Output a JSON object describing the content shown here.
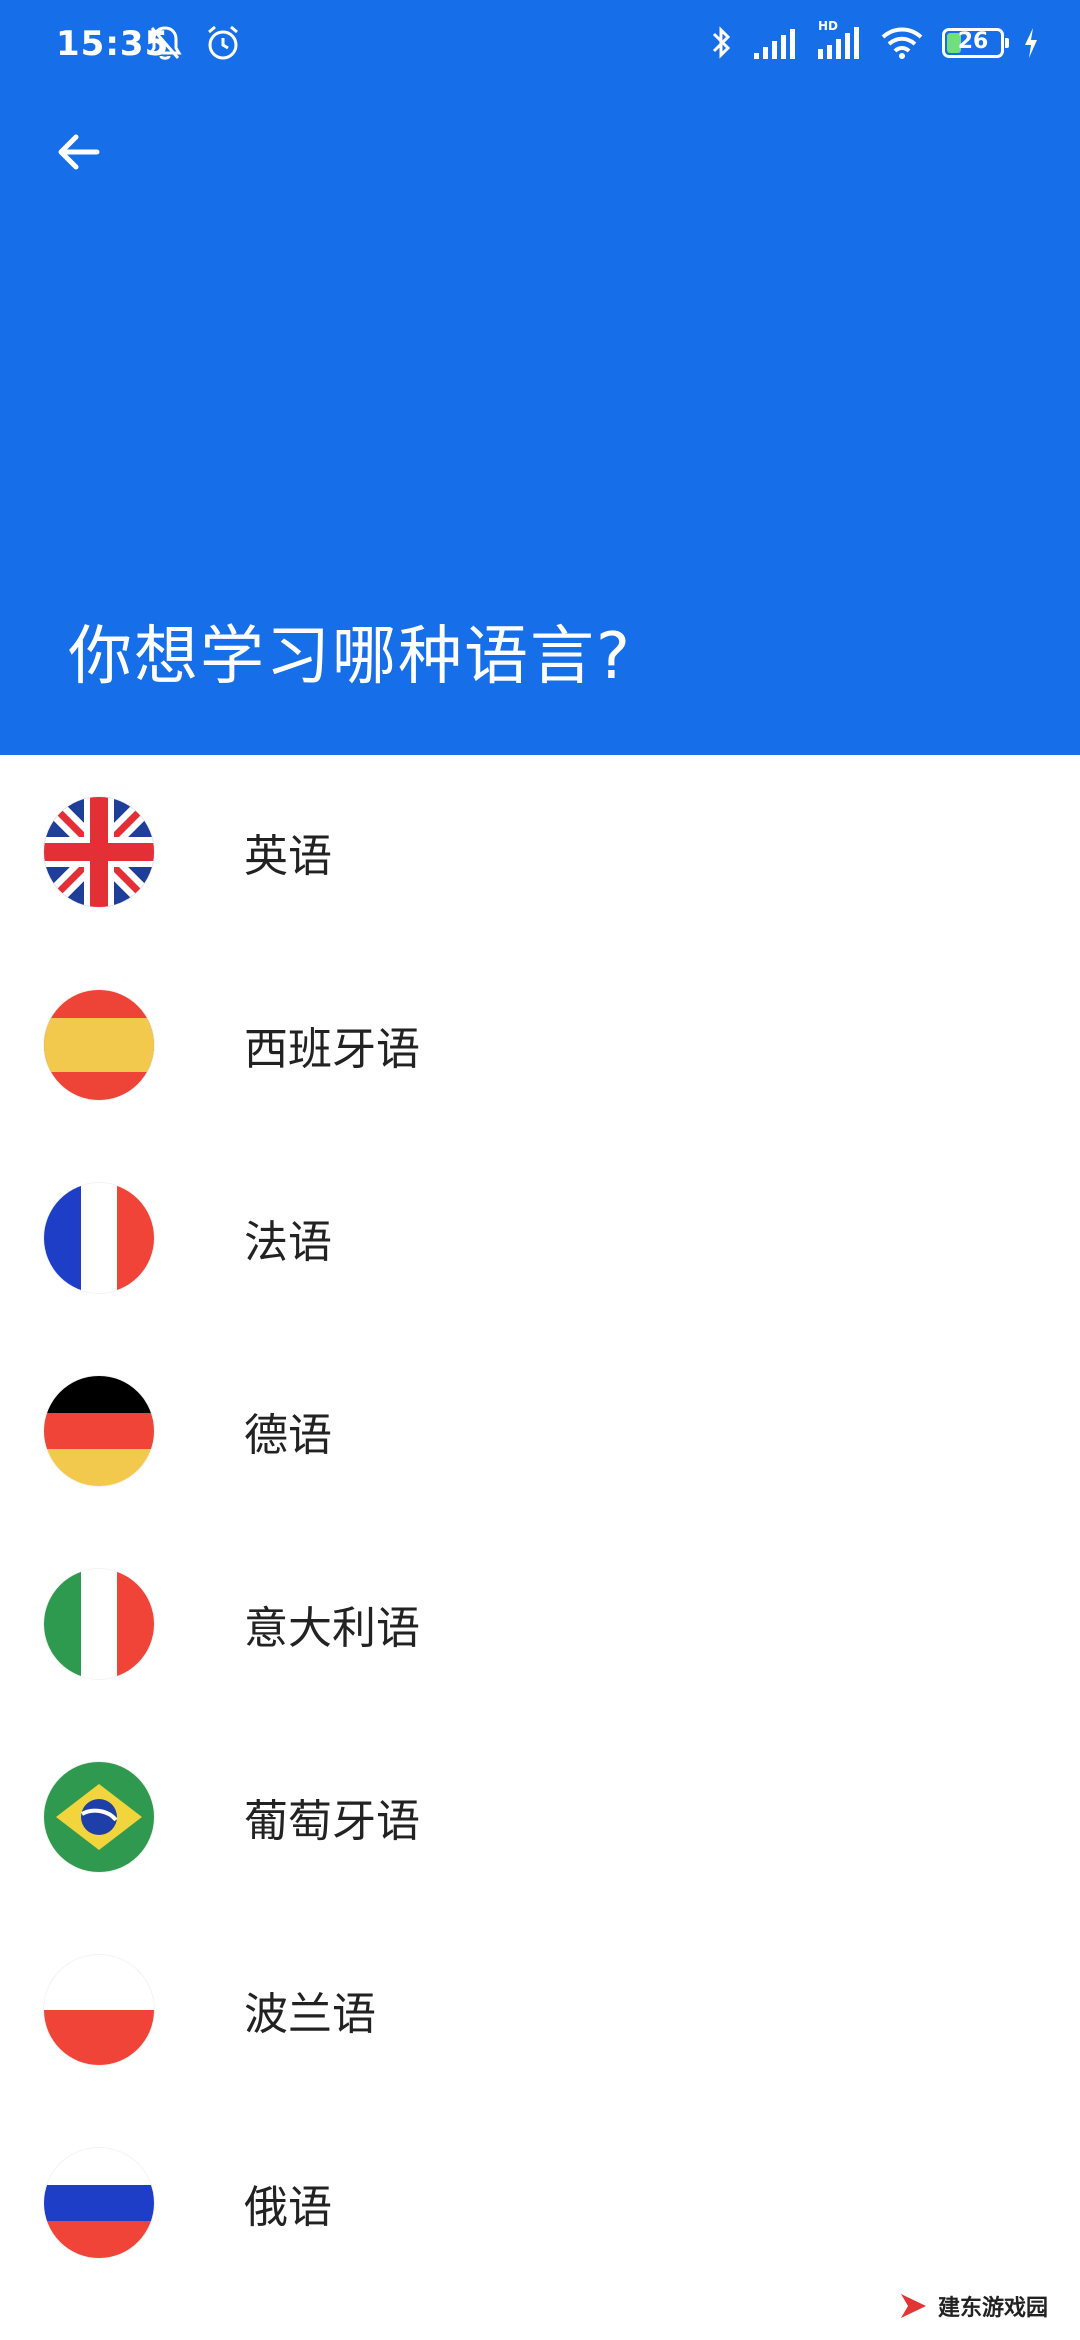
{
  "status_bar": {
    "time": "15:35",
    "battery_level": "26",
    "network_label": "HD"
  },
  "header": {
    "title": "你想学习哪种语言?"
  },
  "languages": [
    {
      "label": "英语",
      "flag": "uk-flag-icon"
    },
    {
      "label": "西班牙语",
      "flag": "spain-flag-icon"
    },
    {
      "label": "法语",
      "flag": "france-flag-icon"
    },
    {
      "label": "德语",
      "flag": "germany-flag-icon"
    },
    {
      "label": "意大利语",
      "flag": "italy-flag-icon"
    },
    {
      "label": "葡萄牙语",
      "flag": "brazil-flag-icon"
    },
    {
      "label": "波兰语",
      "flag": "poland-flag-icon"
    },
    {
      "label": "俄语",
      "flag": "russia-flag-icon"
    }
  ],
  "watermark": {
    "text": "建东游戏园"
  },
  "colors": {
    "header_bg": "#166fe8",
    "text": "#222222"
  }
}
